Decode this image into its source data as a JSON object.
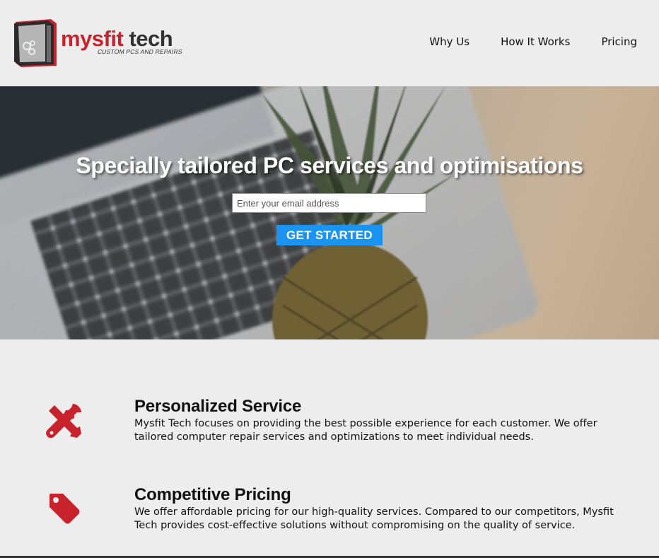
{
  "brand": {
    "name_part1": "mysfit",
    "name_part2": "tech",
    "tagline": "CUSTOM PCS AND REPAIRS",
    "primary_color": "#c8232c"
  },
  "nav": {
    "items": [
      {
        "label": "Why Us"
      },
      {
        "label": "How It Works"
      },
      {
        "label": "Pricing"
      }
    ]
  },
  "hero": {
    "title": "Specially tailored PC services and optimisations",
    "email_placeholder": "Enter your email address",
    "cta_label": "GET STARTED",
    "cta_color": "#1a94f0"
  },
  "features": [
    {
      "icon": "tools-icon",
      "title": "Personalized Service",
      "description": "Mysfit Tech focuses on providing the best possible experience for each customer. We offer tailored computer repair services and optimizations to meet individual needs."
    },
    {
      "icon": "price-tag-icon",
      "title": "Competitive Pricing",
      "description": "We offer affordable pricing for our high-quality services. Compared to our competitors, Mysfit Tech provides cost-effective solutions without compromising on the quality of service."
    }
  ]
}
